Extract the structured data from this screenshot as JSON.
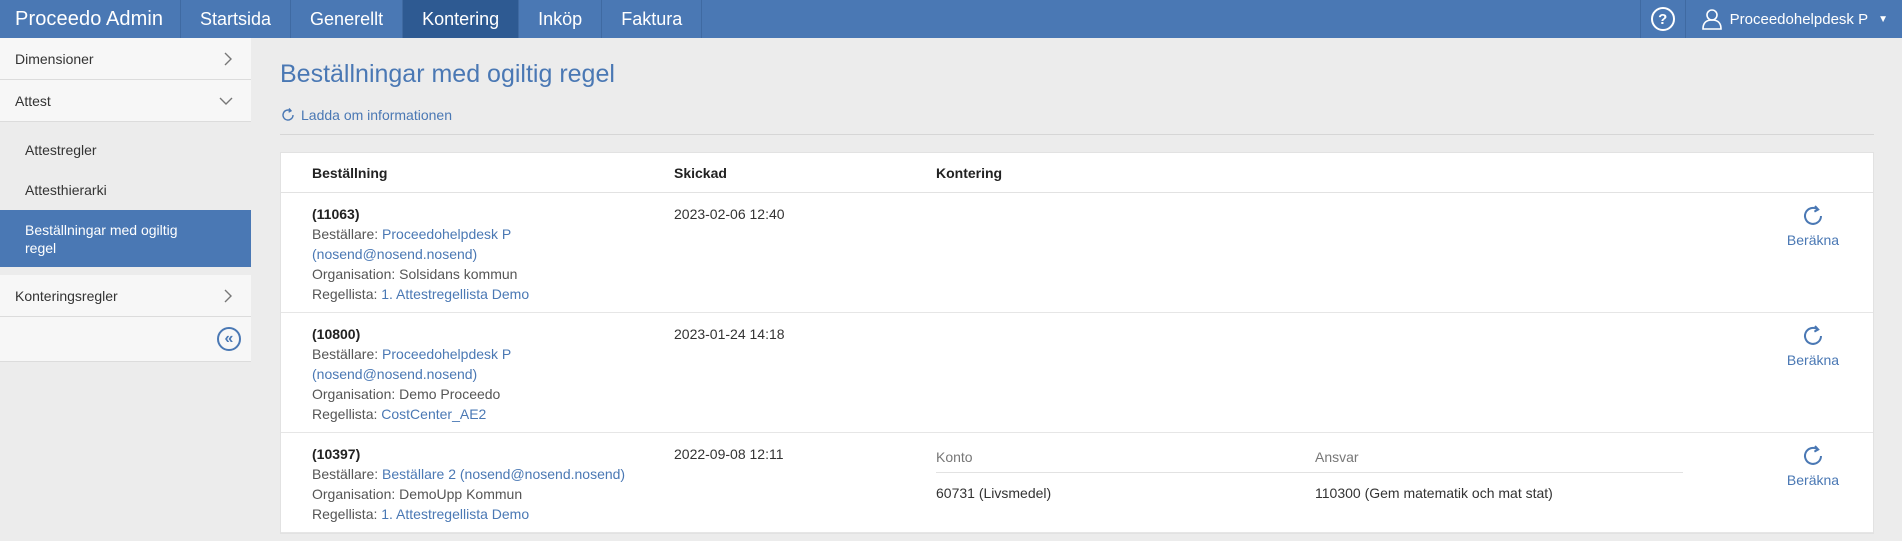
{
  "app": {
    "title": "Proceedo Admin"
  },
  "nav": {
    "items": [
      "Startsida",
      "Generellt",
      "Kontering",
      "Inköp",
      "Faktura"
    ],
    "active": "Kontering"
  },
  "header": {
    "help_icon": "?",
    "user_name": "Proceedohelpdesk P",
    "user_caret": "▼"
  },
  "sidebar": {
    "dimensioner": "Dimensioner",
    "attest": "Attest",
    "attestregler": "Attestregler",
    "attesthierarki": "Attesthierarki",
    "bestallningar": "Beställningar med ogiltig regel",
    "konteringsregler": "Konteringsregler",
    "collapse_icon": "«"
  },
  "main": {
    "title": "Beställningar med ogiltig regel",
    "reload_label": "Ladda om informationen",
    "columns": {
      "order": "Beställning",
      "sent": "Skickad",
      "kontering": "Kontering"
    },
    "calc_label": "Beräkna",
    "labels": {
      "orderer": "Beställare: ",
      "organisation": "Organisation: ",
      "rulelist": "Regellista: "
    },
    "rows": [
      {
        "id": "(11063)",
        "orderer": "Proceedohelpdesk P (nosend@nosend.nosend)",
        "organisation": "Solsidans kommun",
        "rulelist": "1. Attestregellista Demo",
        "sent": "2023-02-06 12:40"
      },
      {
        "id": "(10800)",
        "orderer": "Proceedohelpdesk P (nosend@nosend.nosend)",
        "organisation": "Demo Proceedo",
        "rulelist": "CostCenter_AE2",
        "sent": "2023-01-24 14:18"
      },
      {
        "id": "(10397)",
        "orderer": "Beställare 2 (nosend@nosend.nosend)",
        "organisation": "DemoUpp Kommun",
        "rulelist": "1. Attestregellista Demo",
        "sent": "2022-09-08 12:11",
        "kontering": {
          "konto_label": "Konto",
          "ansvar_label": "Ansvar",
          "konto": "60731 (Livsmedel)",
          "ansvar": "110300 (Gem matematik och mat stat)"
        }
      }
    ]
  }
}
